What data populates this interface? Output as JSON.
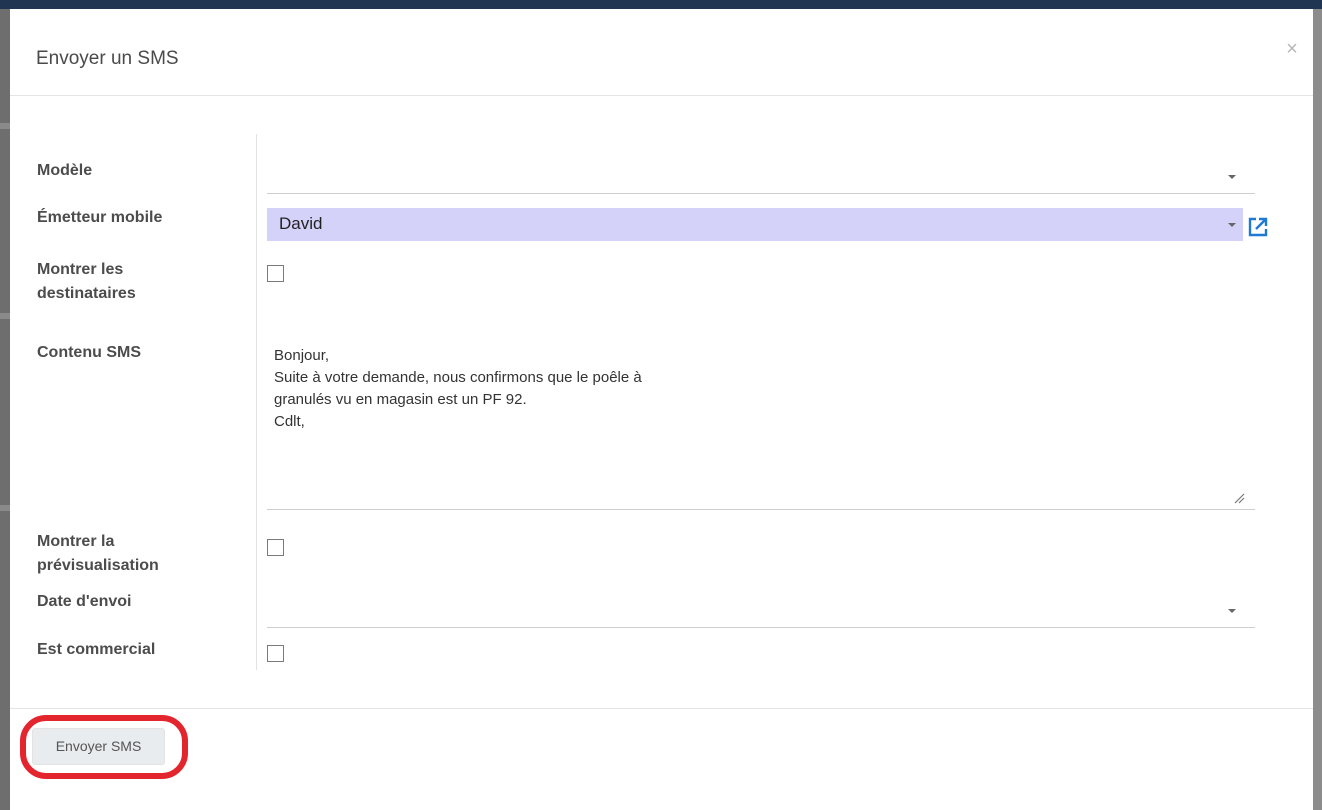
{
  "dialog": {
    "title": "Envoyer un SMS",
    "close_symbol": "×"
  },
  "fields": {
    "template": {
      "label": "Modèle",
      "value": ""
    },
    "mobile_sender": {
      "label": "Émetteur mobile",
      "value": "David"
    },
    "show_recipients": {
      "label_line1": "Montrer les",
      "label_line2": "destinataires",
      "checked": false
    },
    "sms_content": {
      "label": "Contenu SMS",
      "lines": [
        "Bonjour,",
        "Suite à votre demande, nous confirmons que le poêle à",
        "granulés vu en magasin est un PF 92.",
        "Cdlt,"
      ]
    },
    "show_preview": {
      "label_line1": "Montrer la",
      "label_line2": "prévisualisation",
      "checked": false
    },
    "send_date": {
      "label": "Date d'envoi",
      "value": ""
    },
    "is_commercial": {
      "label": "Est commercial",
      "checked": false
    }
  },
  "footer": {
    "send_button_label": "Envoyer SMS",
    "highlight_color": "#e3252e"
  },
  "colors": {
    "selected_field_bg": "#d4d2f9",
    "top_bar": "#1f3552",
    "link_icon": "#1f7ad6"
  },
  "icons": {
    "close": "close-icon",
    "dropdown": "chevron-down-icon",
    "external_link": "external-link-icon",
    "resize": "resize-handle-icon"
  }
}
